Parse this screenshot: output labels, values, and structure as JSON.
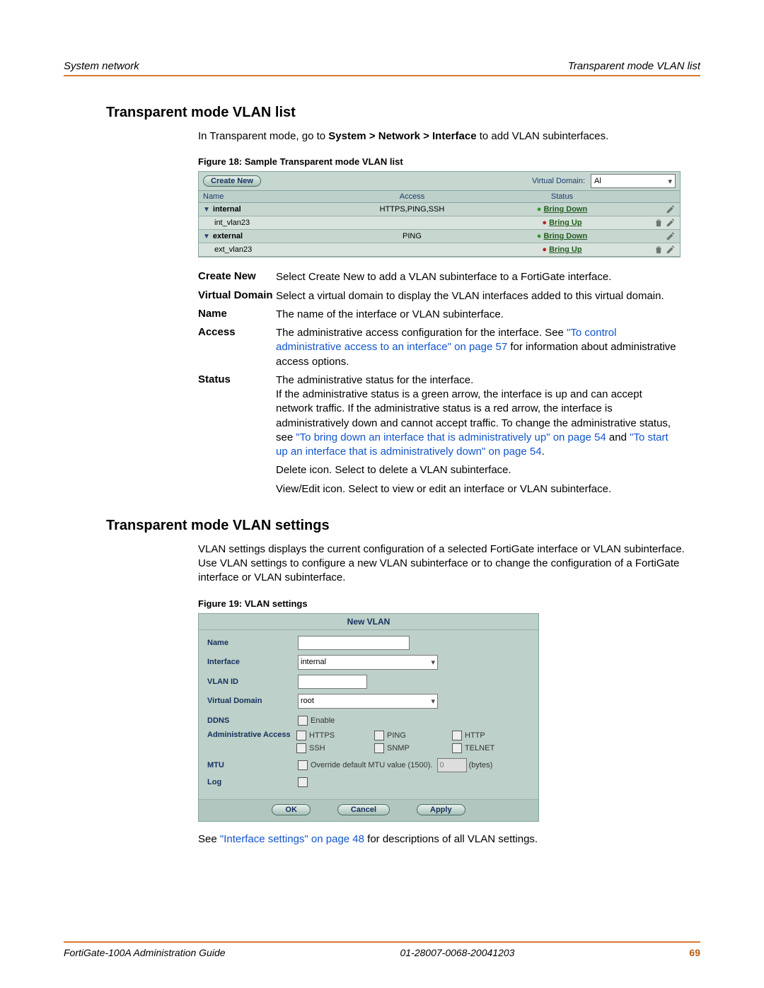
{
  "header": {
    "left": "System network",
    "right": "Transparent mode VLAN list"
  },
  "section1": {
    "heading": "Transparent mode VLAN list",
    "intro_pre": "In Transparent mode, go to ",
    "intro_bold": "System > Network > Interface",
    "intro_post": " to add VLAN subinterfaces.",
    "fig_caption": "Figure 18: Sample Transparent mode VLAN list"
  },
  "fig18": {
    "create_label": "Create New",
    "vd_label": "Virtual Domain:",
    "vd_value": "Al",
    "columns": [
      "Name",
      "Access",
      "Status",
      ""
    ],
    "rows": [
      {
        "kind": "parent",
        "name": "internal",
        "access": "HTTPS,PING,SSH",
        "status_arrow": "green",
        "status_text": "Bring Down",
        "delete": false,
        "edit": true
      },
      {
        "kind": "child",
        "name": "int_vlan23",
        "access": "",
        "status_arrow": "red",
        "status_text": "Bring Up",
        "delete": true,
        "edit": true
      },
      {
        "kind": "parent",
        "name": "external",
        "access": "PING",
        "status_arrow": "green",
        "status_text": "Bring Down",
        "delete": false,
        "edit": true
      },
      {
        "kind": "child",
        "name": "ext_vlan23",
        "access": "",
        "status_arrow": "red",
        "status_text": "Bring Up",
        "delete": true,
        "edit": true
      }
    ]
  },
  "defs": {
    "create_new": {
      "term": "Create New",
      "desc": "Select Create New to add a VLAN subinterface to a FortiGate interface."
    },
    "virtual_domain": {
      "term": "Virtual Domain",
      "desc": "Select a virtual domain to display the VLAN interfaces added to this virtual domain."
    },
    "name": {
      "term": "Name",
      "desc": "The name of the interface or VLAN subinterface."
    },
    "access": {
      "term": "Access",
      "desc_pre": "The administrative access configuration for the interface. See ",
      "link": "\"To control administrative access to an interface\" on page 57",
      "desc_post": " for information about administrative access options."
    },
    "status": {
      "term": "Status",
      "line1": "The administrative status for the interface.",
      "line2_pre": "If the administrative status is a green arrow, the interface is up and can accept network traffic. If the administrative status is a red arrow, the interface is administratively down and cannot accept traffic. To change the administrative status, see ",
      "link1": "\"To bring down an interface that is administratively up\" on page 54",
      "mid": " and ",
      "link2": "\"To start up an interface that is administratively down\" on page 54",
      "post": "."
    },
    "delete_icon": "Delete icon. Select to delete a VLAN subinterface.",
    "edit_icon": "View/Edit icon. Select to view or edit an interface or VLAN subinterface."
  },
  "section2": {
    "heading": "Transparent mode VLAN settings",
    "intro": "VLAN settings displays the current configuration of a selected FortiGate interface or VLAN subinterface. Use VLAN settings to configure a new VLAN subinterface or to change the configuration of a FortiGate interface or VLAN subinterface.",
    "fig_caption": "Figure 19: VLAN settings"
  },
  "fig19": {
    "title": "New VLAN",
    "labels": {
      "name": "Name",
      "interface": "Interface",
      "vlan_id": "VLAN ID",
      "virtual_domain": "Virtual Domain",
      "ddns": "DDNS",
      "admin_access": "Administrative Access",
      "mtu": "MTU",
      "log": "Log"
    },
    "values": {
      "name": "",
      "interface": "internal",
      "vlan_id": "",
      "virtual_domain": "root",
      "mtu_override_label": "Override default MTU value (1500).",
      "mtu_value": "0",
      "mtu_unit": "(bytes)"
    },
    "ddns_enable_label": "Enable",
    "access_options": [
      "HTTPS",
      "PING",
      "HTTP",
      "SSH",
      "SNMP",
      "TELNET"
    ],
    "buttons": {
      "ok": "OK",
      "cancel": "Cancel",
      "apply": "Apply"
    }
  },
  "see_line": {
    "pre": "See ",
    "link": "\"Interface settings\" on page 48",
    "post": " for descriptions of all VLAN settings."
  },
  "footer": {
    "left": "FortiGate-100A Administration Guide",
    "mid": "01-28007-0068-20041203",
    "page": "69"
  }
}
